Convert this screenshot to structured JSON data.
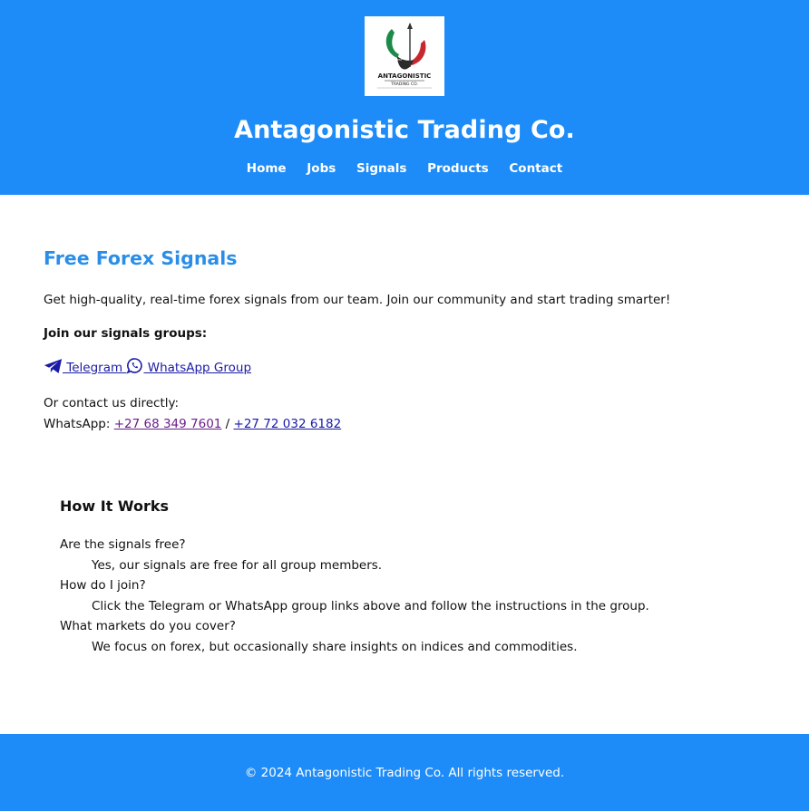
{
  "header": {
    "logo_text": "ANTAGONISTIC",
    "logo_subtext": "TRADING CO.",
    "site_title": "Antagonistic Trading Co.",
    "nav": [
      "Home",
      "Jobs",
      "Signals",
      "Products",
      "Contact"
    ]
  },
  "main": {
    "title": "Free Forex Signals",
    "intro": "Get high-quality, real-time forex signals from our team. Join our community and start trading smarter!",
    "groups_heading": "Join our signals groups:",
    "telegram_label": " Telegram ",
    "whatsapp_label": " WhatsApp Group",
    "contact_line": "Or contact us directly:",
    "whatsapp_prefix": "WhatsApp: ",
    "phone_1": "+27 68 349 7601",
    "separator": " / ",
    "phone_2": "+27 72 032 6182"
  },
  "faq": {
    "title": "How It Works",
    "items": [
      {
        "q": "Are the signals free?",
        "a": "Yes, our signals are free for all group members."
      },
      {
        "q": "How do I join?",
        "a": "Click the Telegram or WhatsApp group links above and follow the instructions in the group."
      },
      {
        "q": "What markets do you cover?",
        "a": "We focus on forex, but occasionally share insights on indices and commodities."
      }
    ]
  },
  "footer": {
    "text": "© 2024 Antagonistic Trading Co. All rights reserved."
  },
  "icons": {
    "telegram": "telegram-icon",
    "whatsapp": "whatsapp-icon"
  },
  "colors": {
    "brand_blue": "#1e8cf8",
    "heading_blue": "#2a8ee8",
    "link": "#1a1aa6",
    "visited_link": "#6a1e8a"
  }
}
